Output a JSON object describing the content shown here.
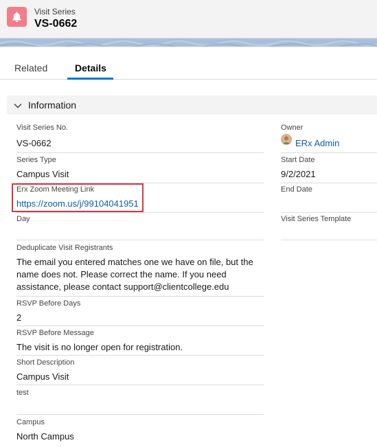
{
  "header": {
    "object_label": "Visit Series",
    "record_name": "VS-0662",
    "icon": "bell-icon",
    "icon_color": "#f27d8a"
  },
  "tabs": [
    {
      "label": "Related",
      "active": false
    },
    {
      "label": "Details",
      "active": true
    }
  ],
  "section": {
    "title": "Information",
    "expanded": true
  },
  "left_fields": {
    "visit_series_no": {
      "label": "Visit Series No.",
      "value": "VS-0662"
    },
    "series_type": {
      "label": "Series Type",
      "value": "Campus Visit"
    },
    "zoom_link": {
      "label": "Erx Zoom Meeting Link",
      "value": "https://zoom.us/j/99104041951"
    },
    "day": {
      "label": "Day",
      "value": ""
    },
    "dedupe": {
      "label": "Deduplicate Visit Registrants",
      "value": "The email you entered matches one we have on file, but the name does not. Please correct the name. If you need assistance, please contact support@clientcollege.edu"
    },
    "rsvp_days": {
      "label": "RSVP Before Days",
      "value": "2"
    },
    "rsvp_message": {
      "label": "RSVP Before Message",
      "value": "The visit is no longer open for registration."
    },
    "short_description": {
      "label": "Short Description",
      "value": "Campus Visit"
    },
    "test": {
      "label": "test",
      "value": ""
    },
    "campus": {
      "label": "Campus",
      "value": "North Campus"
    }
  },
  "right_fields": {
    "owner": {
      "label": "Owner",
      "value": "ERx Admin"
    },
    "start_date": {
      "label": "Start Date",
      "value": "9/2/2021"
    },
    "end_date": {
      "label": "End Date",
      "value": ""
    },
    "template": {
      "label": "Visit Series Template",
      "value": ""
    }
  },
  "colors": {
    "link": "#0b5cab",
    "active_tab": "#0176d3",
    "highlight": "#d9363e"
  }
}
